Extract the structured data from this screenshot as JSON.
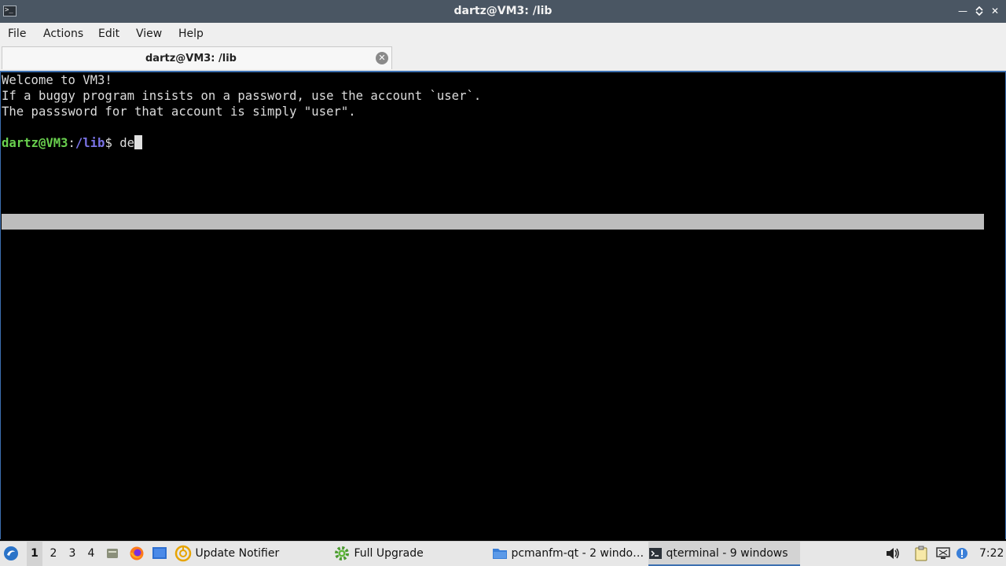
{
  "window": {
    "title": "dartz@VM3: /lib",
    "controls": [
      "minimize",
      "maximize",
      "close"
    ]
  },
  "menubar": {
    "items": [
      "File",
      "Actions",
      "Edit",
      "View",
      "Help"
    ]
  },
  "tabs": [
    {
      "label": "dartz@VM3: /lib",
      "active": true
    }
  ],
  "terminal": {
    "lines": [
      "Welcome to VM3!",
      "If a buggy program insists on a password, use the account `user`.",
      "The passsword for that account is simply \"user\"."
    ],
    "prompt": {
      "user_host": "dartz@VM3",
      "colon": ":",
      "path": "/lib",
      "symbol": "$ ",
      "input": "de"
    }
  },
  "taskbar": {
    "desktops": [
      "1",
      "2",
      "3",
      "4"
    ],
    "active_desktop": "1",
    "quicklaunch": [
      "file-manager-icon",
      "firefox-icon",
      "desktop-icon"
    ],
    "tasks": [
      {
        "label": "Update Notifier",
        "icon": "update-notifier-icon"
      },
      {
        "label": "Full Upgrade",
        "icon": "gear-icon"
      },
      {
        "label": "pcmanfm-qt - 2 windo…",
        "icon": "folder-icon"
      },
      {
        "label": "qterminal - 9 windows",
        "icon": "terminal-icon",
        "active": true
      }
    ],
    "tray": [
      "volume-icon",
      "clipboard-icon",
      "network-icon",
      "notification-icon"
    ],
    "clock": "7:22"
  },
  "colors": {
    "titlebar": "#4a5663",
    "prompt_user": "#69d04e",
    "prompt_path": "#7b74e8",
    "accent": "#3c6fb0"
  }
}
